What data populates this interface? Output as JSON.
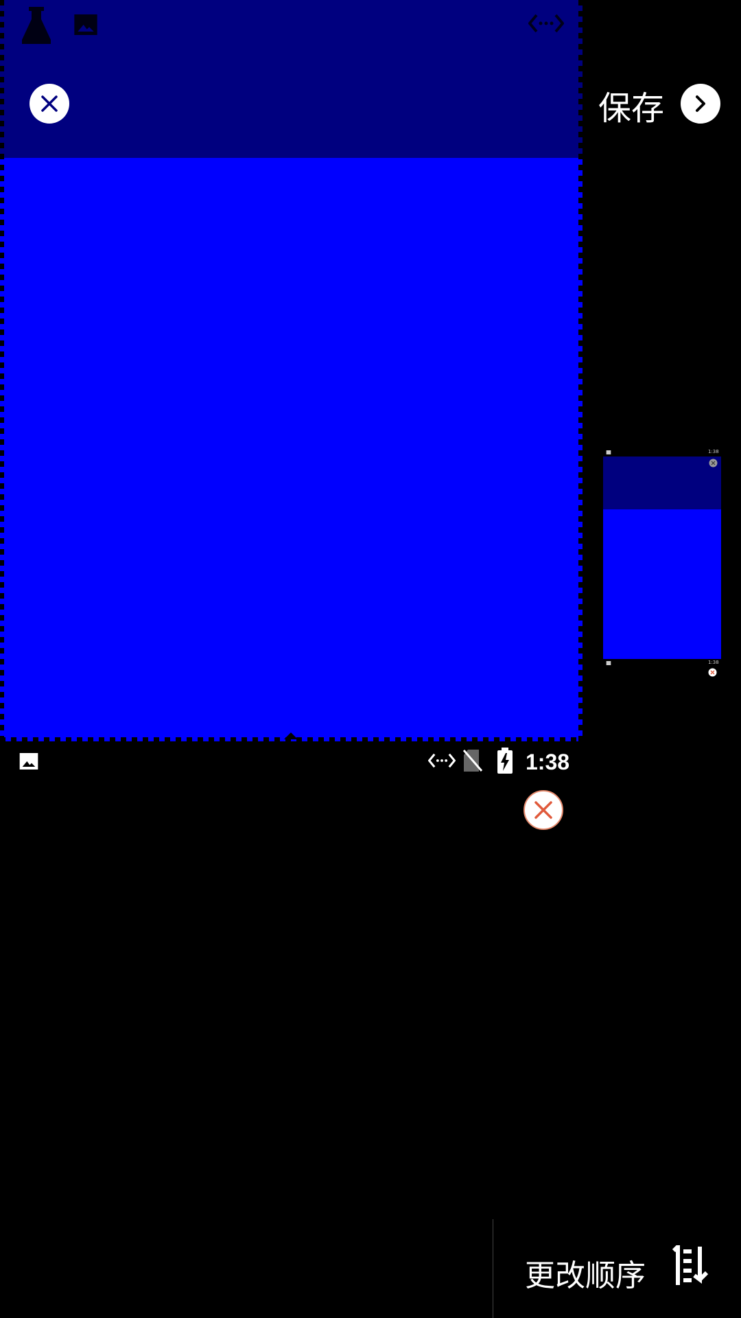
{
  "header": {
    "save_label": "保存"
  },
  "status_bar": {
    "time": "1:38"
  },
  "thumbnail": {
    "time_top": "1:38",
    "time_bottom": "1:38"
  },
  "footer": {
    "reorder_label": "更改顺序"
  },
  "icons": {
    "close": "close-icon",
    "next": "chevron-right-icon",
    "image": "image-icon",
    "code": "code-icon",
    "no_sim": "no-sim-icon",
    "battery": "battery-charging-icon",
    "reorder": "reorder-icon"
  },
  "colors": {
    "capture_top": "#00007f",
    "capture_main": "#0000ff",
    "close_accent": "#e05a3c"
  }
}
